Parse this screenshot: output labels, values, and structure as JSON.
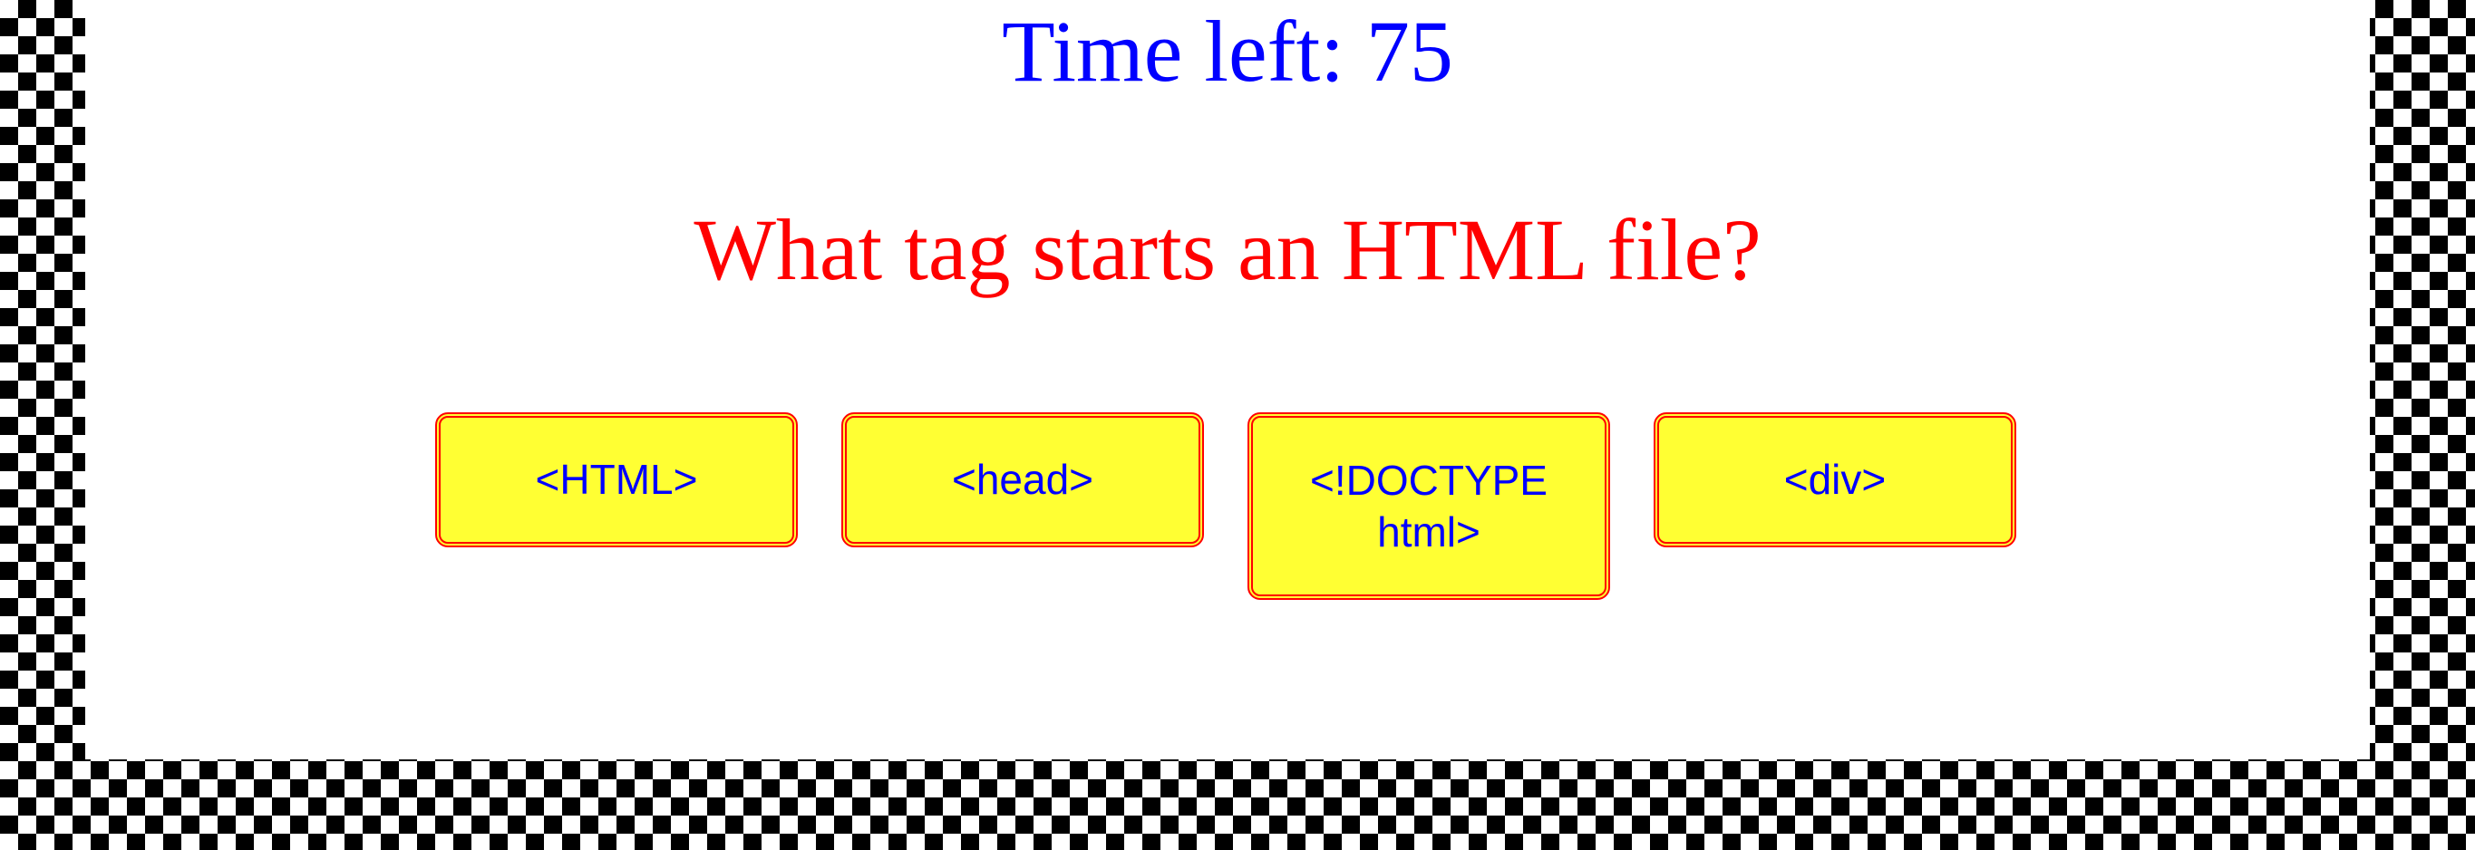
{
  "timer": {
    "label": "Time left:",
    "value": 75
  },
  "question": {
    "text": "What tag starts an HTML file?"
  },
  "answers": [
    {
      "label": "<HTML>"
    },
    {
      "label": "<head>"
    },
    {
      "label": "<!DOCTYPE html>"
    },
    {
      "label": "<div>"
    }
  ],
  "colors": {
    "timer_text": "#0000ff",
    "question_text": "#ff0000",
    "answer_background": "#ffff33",
    "answer_border": "#ff0000",
    "answer_text": "#0000ff",
    "checker_dark": "#000000",
    "checker_light": "#ffffff"
  }
}
